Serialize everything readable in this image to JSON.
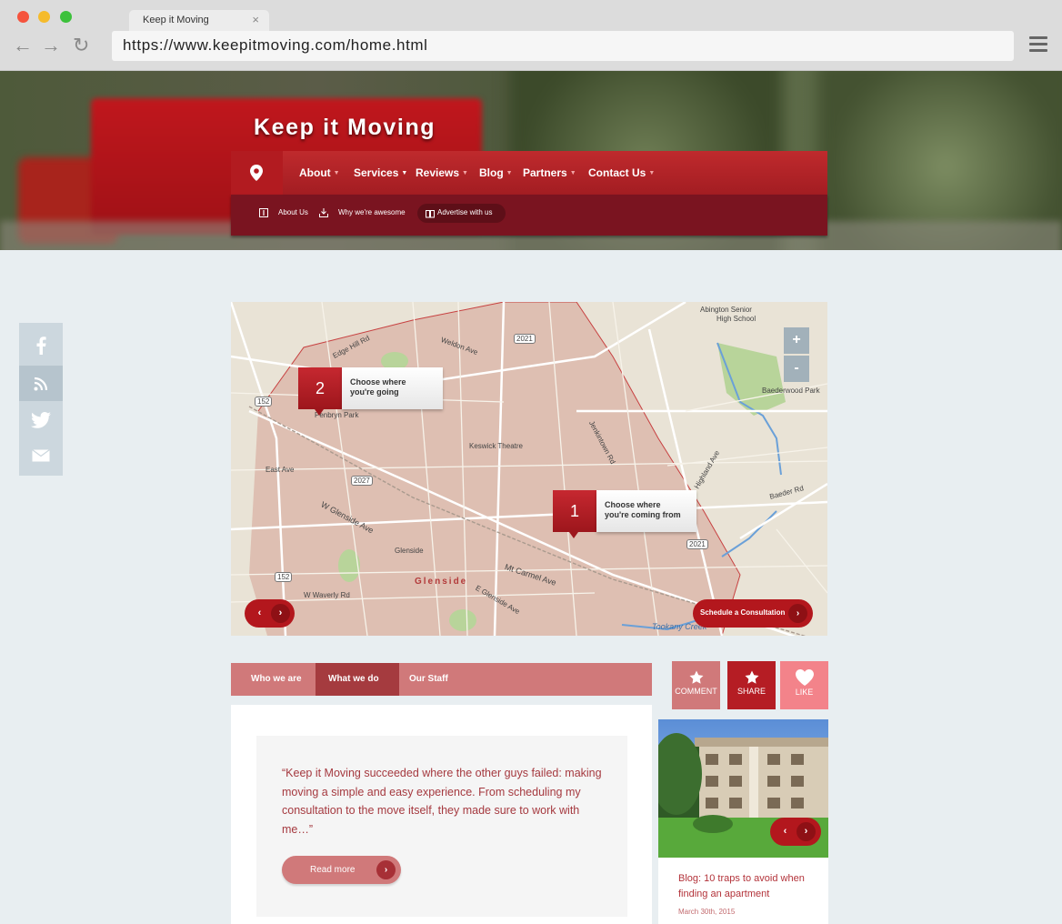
{
  "browser": {
    "tab_title": "Keep it Moving",
    "tab_close": "×",
    "back": "←",
    "forward": "→",
    "reload": "↻",
    "url": "https://www.keepitmoving.com/home.html"
  },
  "site": {
    "brand": "Keep it Moving",
    "nav": [
      {
        "label": "About"
      },
      {
        "label": "Services"
      },
      {
        "label": "Reviews"
      },
      {
        "label": "Blog"
      },
      {
        "label": "Partners"
      },
      {
        "label": "Contact Us"
      }
    ],
    "subnav": [
      {
        "label": "About Us"
      },
      {
        "label": "Why we're awesome"
      },
      {
        "label": "Advertise with us"
      }
    ]
  },
  "social": [
    "facebook-icon",
    "rss-icon",
    "twitter-icon",
    "email-icon"
  ],
  "map": {
    "zoom_in": "+",
    "zoom_out": "-",
    "marker_1": {
      "num": "1",
      "line1": "Choose where",
      "line2": "you're coming from"
    },
    "marker_2": {
      "num": "2",
      "line1": "Choose where",
      "line2": "you're going"
    },
    "schedule": "Schedule a Consultation",
    "labels": {
      "abington": "Abington Senior",
      "highschool": "High School",
      "baederwood": "Baederwood Park",
      "keswick": "Keswick Theatre",
      "penbryn": "Penbryn Park",
      "glenside_station": "Glenside",
      "glenside": "Glenside",
      "tookany": "Tookany Creek",
      "r2021a": "2021",
      "r2021b": "2021",
      "r2027": "2027",
      "r152a": "152",
      "r152b": "152",
      "edge_hill": "Edge Hill Rd",
      "w_glenside": "W Glenside Ave",
      "mt_carmel": "Mt Carmel Ave",
      "jenkintown": "Jenkintown Rd",
      "highland": "Highland Ave",
      "baeder_rd": "Baeder Rd",
      "e_glenside": "E Glenside Ave",
      "east_ave": "East Ave",
      "w_waverly": "W Waverly Rd",
      "weldon": "Weldon Ave"
    }
  },
  "tabs": [
    {
      "label": "Who we are"
    },
    {
      "label": "What we do"
    },
    {
      "label": "Our Staff"
    }
  ],
  "quote": "“Keep it Moving succeeded where the other guys failed: making moving a simple and easy experience. From scheduling my consultation to the move itself, they made sure to work with me…”",
  "read_more": "Read more",
  "actions": [
    {
      "label": "COMMENT"
    },
    {
      "label": "SHARE"
    },
    {
      "label": "LIKE"
    }
  ],
  "blog": {
    "title": "Blog: 10 traps to avoid when finding an apartment",
    "date": "March 30th, 2015"
  },
  "colors": {
    "brand_red": "#b3171d",
    "dark_red": "#7a1420",
    "pink": "#d0797a",
    "like": "#f3838a"
  }
}
